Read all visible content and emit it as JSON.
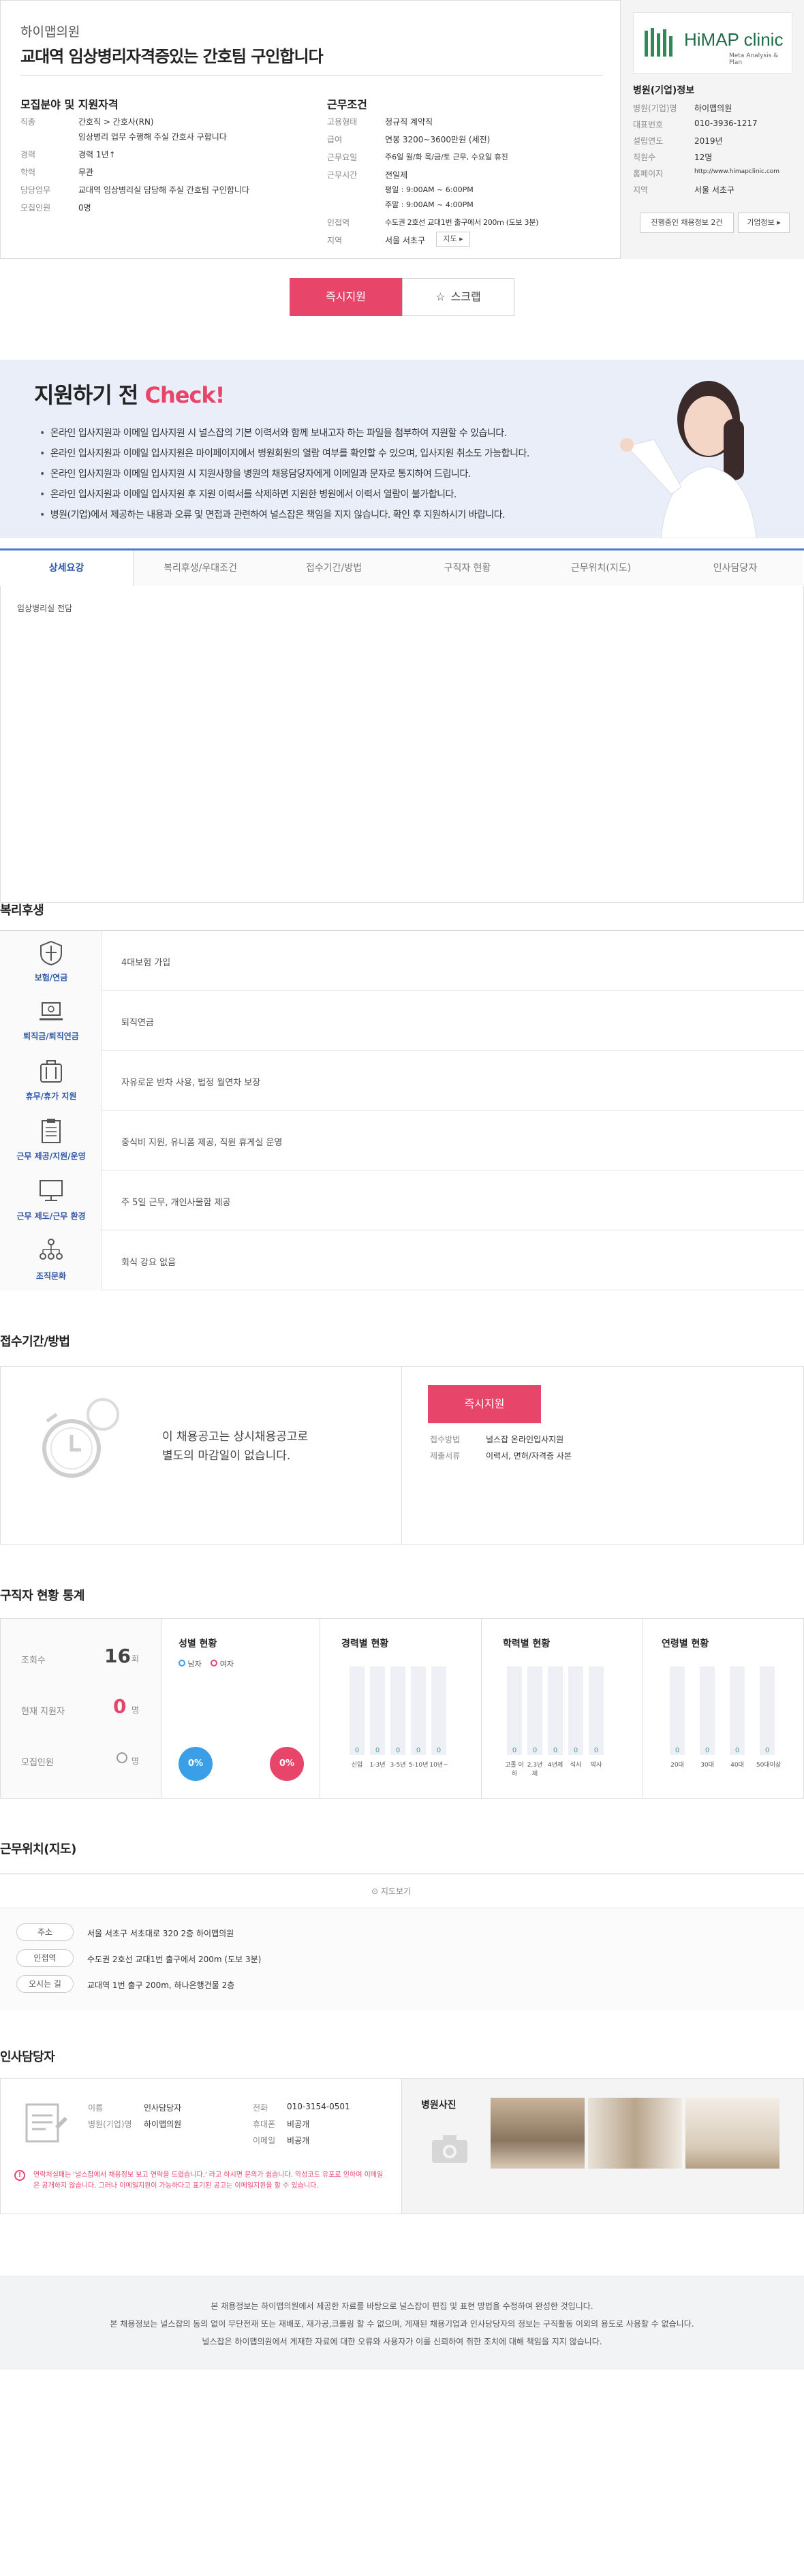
{
  "header": {
    "company": "하이맵의원",
    "title": "교대역 임상병리자격증있는 간호팀 구인합니다"
  },
  "recruit": {
    "heading": "모집분야 및 지원자격",
    "rows": [
      {
        "label": "직종",
        "value": "간호직 > 간호사(RN)"
      },
      {
        "label": "",
        "value": "임상병리 업무 수행해 주실 간호사 구합니다"
      },
      {
        "label": "경력",
        "value": "경력 1년↑"
      },
      {
        "label": "학력",
        "value": "무관"
      },
      {
        "label": "담당업무",
        "value": "교대역 임상병리실 담당해 주실 간호팀 구인합니다"
      },
      {
        "label": "모집인원",
        "value": "0명"
      }
    ]
  },
  "work": {
    "heading": "근무조건",
    "rows": [
      {
        "label": "고용형태",
        "value": "정규직  계약직"
      },
      {
        "label": "급여",
        "value": "연봉 3200~3600만원 (세전)"
      },
      {
        "label": "근무요일",
        "value": "주6일 월/화 목/금/토 근무, 수요일 휴진"
      },
      {
        "label": "근무시간",
        "value": "전일제"
      },
      {
        "label": "",
        "value": "평일 : 9:00AM ~ 6:00PM"
      },
      {
        "label": "",
        "value": "주말 : 9:00AM ~ 4:00PM"
      },
      {
        "label": "인접역",
        "value": "수도권 2호선 교대1번 출구에서 200m (도보 3분)"
      },
      {
        "label": "지역",
        "value": "서울 서초구"
      }
    ],
    "map_button": "지도 ▸"
  },
  "sidebar": {
    "logo_text": "HiMAP clinic",
    "logo_sub": "Meta Analysis & Plan",
    "heading": "병원(기업)정보",
    "rows": [
      {
        "label": "병원(기업)명",
        "value": "하이맵의원"
      },
      {
        "label": "대표번호",
        "value": "010-3936-1217"
      },
      {
        "label": "설립연도",
        "value": "2019년"
      },
      {
        "label": "직원수",
        "value": "12명"
      },
      {
        "label": "홈페이지",
        "value": "http://www.himapclinic.com"
      },
      {
        "label": "지역",
        "value": "서울 서초구"
      }
    ],
    "btn_jobs": "진행중인 채용정보 2건",
    "btn_info": "기업정보 ▸"
  },
  "actions": {
    "apply": "즉시지원",
    "scrap": "스크랩"
  },
  "check": {
    "title_a": "지원하기 전 ",
    "title_b": "Check!",
    "items": [
      "온라인 입사지원과 이메일 입사지원 시 널스잡의 기본 이력서와 함께 보내고자 하는 파일을 첨부하여 지원할 수 있습니다.",
      "온라인 입사지원과 이메일 입사지원은 마이페이지에서 병원회원의 열람 여부를 확인할 수 있으며, 입사지원 취소도 가능합니다.",
      "온라인 입사지원과 이메일 입사지원 시 지원사항을 병원의 채용담당자에게 이메일과 문자로 통지하여 드립니다.",
      "온라인 입사지원과 이메일 입사지원 후 지원 이력서를 삭제하면 지원한 병원에서 이력서 열람이 불가합니다.",
      "병원(기업)에서 제공하는 내용과 오류 및 면접과 관련하여 널스잡은 책임을 지지 않습니다. 확인 후 지원하시기 바랍니다."
    ]
  },
  "tabs": [
    "상세요강",
    "복리후생/우대조건",
    "접수기간/방법",
    "구직자 현황",
    "근무위치(지도)",
    "인사담당자"
  ],
  "detail_text": "임상병리실 전담",
  "welfare": {
    "title": "복리후생",
    "items": [
      {
        "name": "보험/연금",
        "text": "4대보험 가입"
      },
      {
        "name": "퇴직금/퇴직연금",
        "text": "퇴직연금"
      },
      {
        "name": "휴무/휴가 지원",
        "text": "자유로운 반차 사용, 법정 월연차 보장"
      },
      {
        "name": "근무 제공/지원/운영",
        "text": "중식비 지원, 유니폼 제공, 직원 휴게실 운영"
      },
      {
        "name": "근무 제도/근무 환경",
        "text": "주 5일 근무, 개인사물함 제공"
      },
      {
        "name": "조직문화",
        "text": "회식 강요 없음"
      }
    ]
  },
  "period": {
    "title": "접수기간/방법",
    "line1": "이 채용공고는 상시채용공고로",
    "line2": "별도의 마감일이 없습니다.",
    "apply": "즉시지원",
    "method_label": "접수방법",
    "method_value": "널스잡 온라인입사지원",
    "docs_label": "제출서류",
    "docs_value": "이력서, 면허/자격증 사본"
  },
  "stats": {
    "title": "구직자 현황 통계",
    "views_label": "조회수",
    "views": "16",
    "views_unit": "회",
    "applicants_label": "현재 지원자",
    "applicants": "0",
    "applicants_unit": "명",
    "recruits_label": "모집인원",
    "recruits": "0",
    "recruits_unit": "명",
    "gender_title": "성별 현황",
    "male": "남자",
    "female": "여자",
    "male_pct": "0%",
    "female_pct": "0%",
    "career_title": "경력별 현황",
    "career_labels": [
      "신입",
      "1-3년",
      "3-5년",
      "5-10년",
      "10년~"
    ],
    "career_values": [
      "0",
      "0",
      "0",
      "0",
      "0"
    ],
    "edu_title": "학력별 현황",
    "edu_labels": [
      "고졸 이하",
      "2,3년제",
      "4년제",
      "석사",
      "박사"
    ],
    "edu_values": [
      "0",
      "0",
      "0",
      "0",
      "0"
    ],
    "age_title": "연령별 현황",
    "age_labels": [
      "20대",
      "30대",
      "40대",
      "50대이상"
    ],
    "age_values": [
      "0",
      "0",
      "0",
      "0"
    ]
  },
  "map": {
    "title": "근무위치(지도)",
    "view_btn": "지도보기",
    "rows": [
      {
        "label": "주소",
        "value": "서울 서초구 서초대로 320 2층 하이맵의원"
      },
      {
        "label": "인접역",
        "value": "수도권 2호선 교대1번 출구에서 200m (도보 3분)"
      },
      {
        "label": "오시는 길",
        "value": "교대역 1번 출구 200m, 하나은행건물 2층"
      }
    ]
  },
  "hr": {
    "title": "인사담당자",
    "name_label": "이름",
    "name": "인사담당자",
    "org_label": "병원(기업)명",
    "org": "하이맵의원",
    "phone_label": "전화",
    "phone": "010-3154-0501",
    "mobile_label": "휴대폰",
    "mobile": "비공개",
    "email_label": "이메일",
    "email": "비공개",
    "warning": "연락처실패는 '널스잡에서 채용정보 보고 연락을 드렸습니다.' 라고 하시면 문의가 쉽습니다. 악성코드 유포로 인하여 이메일은 공개하지 않습니다. 그러나 이메일지원이 가능하다고 표기된 공고는 이메일지원을 할 수 있습니다.",
    "photos_title": "병원사진"
  },
  "footer": {
    "line1": "본 채용정보는 하이맵의원에서 제공한 자료를 바탕으로 널스잡이 편집 및 표현 방법을 수정하여 완성한 것입니다.",
    "line2": "본 채용정보는 널스잡의 동의 없이 무단전재 또는 재배포, 재가공,크롤링 할 수 없으며, 게재된 채용기업과 인사담당자의 정보는 구직활동 이외의 용도로 사용할 수 없습니다.",
    "line3": "널스잡은 하이맵의원에서 게재한 자료에 대한 오류와 사용자가 이를 신뢰하여 취한 조치에 대해 책임을 지지 않습니다."
  },
  "colors": {
    "accent": "#e8456b",
    "blue": "#3a6fc4",
    "navy": "#2d57a6"
  }
}
